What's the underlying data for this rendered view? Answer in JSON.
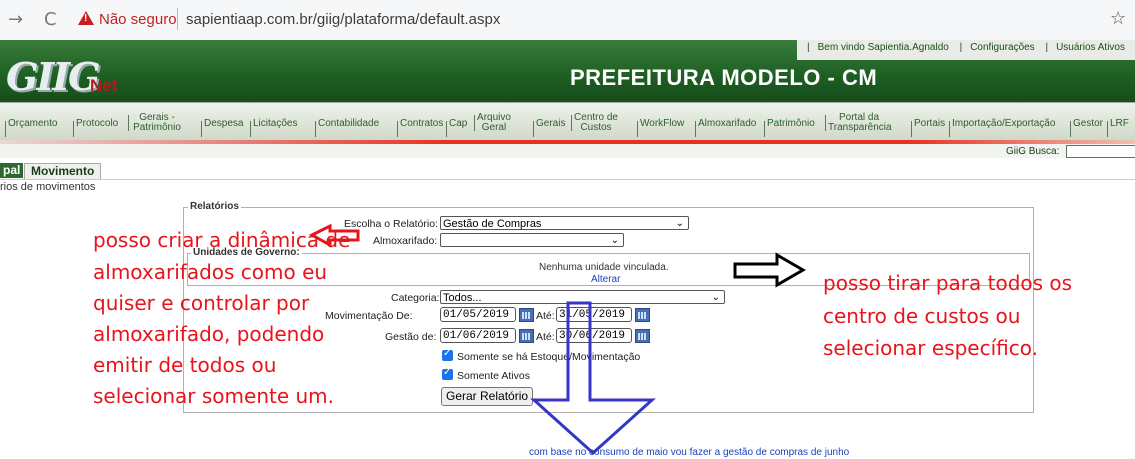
{
  "browser": {
    "back_icon": "→",
    "reload_icon": "C",
    "insecure_label": "Não seguro",
    "url": "sapientiaap.com.br/giig/plataforma/default.aspx",
    "star_icon": "☆"
  },
  "header": {
    "logo_main": "GIIG",
    "logo_sub": "Net",
    "welcome": "Bem vindo Sapientia.Agnaldo",
    "config": "Configurações",
    "users": "Usuários Ativos",
    "title": "PREFEITURA MODELO - CM"
  },
  "menu": [
    "Orçamento",
    "Protocolo",
    "Gerais - Patrimônio",
    "Despesa",
    "Licitações",
    "Contabilidade",
    "Contratos",
    "Cap",
    "Arquivo Geral",
    "Gerais",
    "Centro de Custos",
    "WorkFlow",
    "Almoxarifado",
    "Patrimônio",
    "Portal da Transparência",
    "Portais",
    "Importação/Exportação",
    "Gestor",
    "LRF"
  ],
  "busca": {
    "label": "GiiG Busca:"
  },
  "tabs": {
    "first": "pal",
    "second": "Movimento"
  },
  "subtitle": "rios de movimentos",
  "form": {
    "legend": "Relatórios",
    "relatorio_label": "Escolha o Relatório:",
    "relatorio_value": "Gestão de Compras",
    "almox_label": "Almoxarifado:",
    "almox_value": "",
    "unidades_legend": "Unidades de Governo:",
    "nenhuma": "Nenhuma unidade vinculada.",
    "alterar": "Alterar",
    "categoria_label": "Categoria:",
    "categoria_value": "Todos...",
    "mov_label": "Movimentação De:",
    "mov_de": "01/05/2019",
    "ate_label": "Até:",
    "mov_ate": "31/05/2019",
    "gestao_label": "Gestão de:",
    "gestao_de": "01/06/2019",
    "gestao_ate": "30/06/2019",
    "check1": "Somente se há Estoque/Movimentação",
    "check2": "Somente Ativos",
    "button": "Gerar Relatório"
  },
  "annotations": {
    "left": [
      "posso criar a dinâmica de",
      "almoxarifados como eu",
      "quiser e controlar por",
      "almoxarifado, podendo",
      "emitir de todos ou",
      "selecionar somente um."
    ],
    "right": [
      "posso tirar para todos os",
      "centro de custos ou",
      "selecionar específico."
    ],
    "footer": "com base no consumo de maio vou fazer a gestão de compras de junho"
  }
}
